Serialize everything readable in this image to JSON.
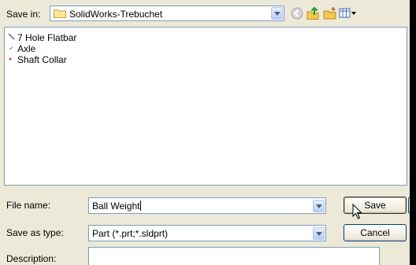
{
  "save_in": {
    "label": "Save in:",
    "value": "SolidWorks-Trebuchet"
  },
  "files": [
    {
      "name": "7 Hole Flatbar",
      "icon": "part-file-icon"
    },
    {
      "name": "Axle",
      "icon": "part-file-icon"
    },
    {
      "name": "Shaft Collar",
      "icon": "part-file-icon"
    }
  ],
  "file_name": {
    "label": "File name:",
    "value": "Ball Weight"
  },
  "save_as_type": {
    "label": "Save as type:",
    "value": "Part (*.prt;*.sldprt)"
  },
  "description": {
    "label": "Description:",
    "value": ""
  },
  "buttons": {
    "save": "Save",
    "cancel": "Cancel"
  },
  "colors": {
    "dialog_bg": "#ece9d8",
    "field_border": "#7f9db9",
    "button_border": "#003c74"
  }
}
